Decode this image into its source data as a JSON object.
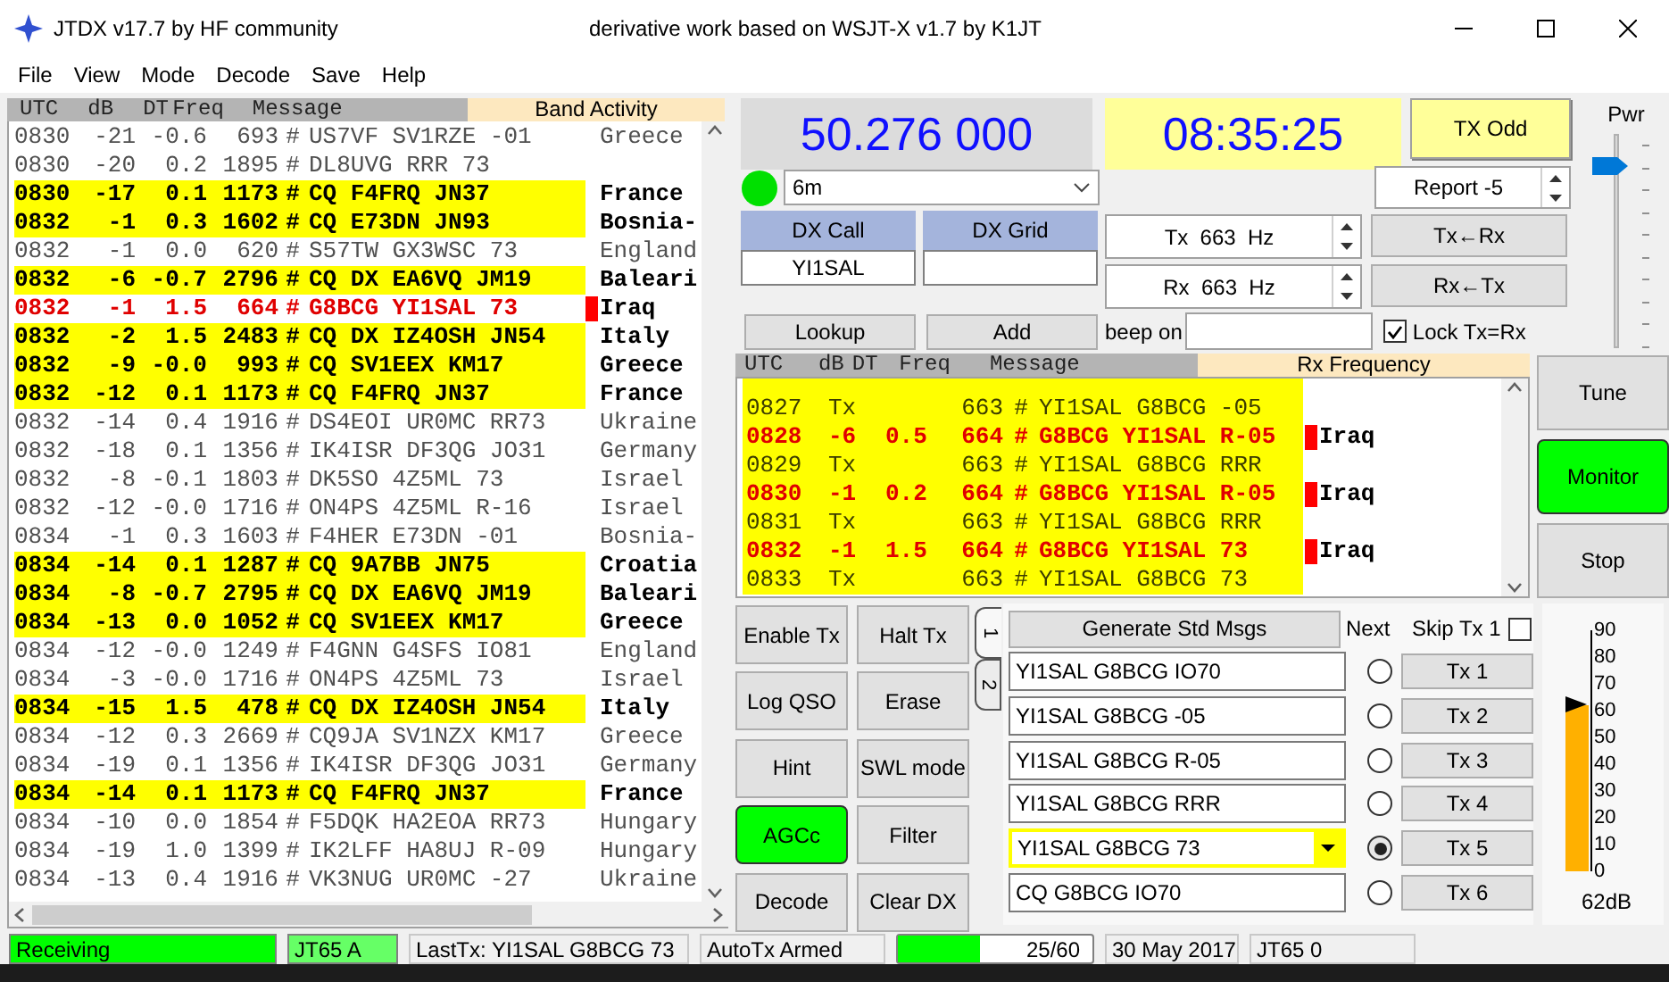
{
  "window": {
    "title": "JTDX v17.7  by HF community",
    "subtitle": "derivative work based on WSJT-X v1.7 by K1JT"
  },
  "menu": [
    "File",
    "View",
    "Mode",
    "Decode",
    "Save",
    "Help"
  ],
  "band_activity": {
    "title": "Band Activity",
    "columns": [
      "UTC",
      "dB",
      "DT",
      "Freq",
      "Message"
    ],
    "rows": [
      {
        "utc": "0830",
        "db": "-21",
        "dt": "-0.6",
        "freq": "693",
        "mode": "#",
        "message": "US7VF SV1RZE -01",
        "country": "Greece",
        "kind": "normal"
      },
      {
        "utc": "0830",
        "db": "-20",
        "dt": "0.2",
        "freq": "1895",
        "mode": "#",
        "message": "DL8UVG RRR 73",
        "kind": "normal"
      },
      {
        "utc": "0830",
        "db": "-17",
        "dt": "0.1",
        "freq": "1173",
        "mode": "#",
        "message": "CQ F4FRQ JN37",
        "country": "France",
        "kind": "cq"
      },
      {
        "utc": "0832",
        "db": "-1",
        "dt": "0.3",
        "freq": "1602",
        "mode": "#",
        "message": "CQ E73DN JN93",
        "country": "Bosnia-",
        "kind": "cq"
      },
      {
        "utc": "0832",
        "db": "-1",
        "dt": "0.0",
        "freq": "620",
        "mode": "#",
        "message": "S57TW GX3WSC 73",
        "country": "England",
        "kind": "normal"
      },
      {
        "utc": "0832",
        "db": "-6",
        "dt": "-0.7",
        "freq": "2796",
        "mode": "#",
        "message": "CQ DX EA6VQ JM19",
        "country": "Baleari",
        "kind": "cq"
      },
      {
        "utc": "0832",
        "db": "-1",
        "dt": "1.5",
        "freq": "664",
        "mode": "#",
        "message": "G8BCG YI1SAL 73",
        "country": "Iraq",
        "kind": "mine"
      },
      {
        "utc": "0832",
        "db": "-2",
        "dt": "1.5",
        "freq": "2483",
        "mode": "#",
        "message": "CQ DX IZ4OSH JN54",
        "country": "Italy",
        "kind": "cq"
      },
      {
        "utc": "0832",
        "db": "-9",
        "dt": "-0.0",
        "freq": "993",
        "mode": "#",
        "message": "CQ SV1EEX KM17",
        "country": "Greece",
        "kind": "cq"
      },
      {
        "utc": "0832",
        "db": "-12",
        "dt": "0.1",
        "freq": "1173",
        "mode": "#",
        "message": "CQ F4FRQ JN37",
        "country": "France",
        "kind": "cq"
      },
      {
        "utc": "0832",
        "db": "-14",
        "dt": "0.4",
        "freq": "1916",
        "mode": "#",
        "message": "DS4EOI UR0MC RR73",
        "country": "Ukraine",
        "kind": "normal"
      },
      {
        "utc": "0832",
        "db": "-18",
        "dt": "0.1",
        "freq": "1356",
        "mode": "#",
        "message": "IK4ISR DF3QG JO31",
        "country": "Germany",
        "kind": "normal"
      },
      {
        "utc": "0832",
        "db": "-8",
        "dt": "-0.1",
        "freq": "1803",
        "mode": "#",
        "message": "DK5SO 4Z5ML 73",
        "country": "Israel",
        "kind": "normal"
      },
      {
        "utc": "0832",
        "db": "-12",
        "dt": "-0.0",
        "freq": "1716",
        "mode": "#",
        "message": "ON4PS 4Z5ML R-16",
        "country": "Israel",
        "kind": "normal"
      },
      {
        "utc": "0834",
        "db": "-1",
        "dt": "0.3",
        "freq": "1603",
        "mode": "#",
        "message": "F4HER E73DN -01",
        "country": "Bosnia-",
        "kind": "normal"
      },
      {
        "utc": "0834",
        "db": "-14",
        "dt": "0.1",
        "freq": "1287",
        "mode": "#",
        "message": "CQ 9A7BB JN75",
        "country": "Croatia",
        "kind": "cq"
      },
      {
        "utc": "0834",
        "db": "-8",
        "dt": "-0.7",
        "freq": "2795",
        "mode": "#",
        "message": "CQ DX EA6VQ JM19",
        "country": "Baleari",
        "kind": "cq"
      },
      {
        "utc": "0834",
        "db": "-13",
        "dt": "0.0",
        "freq": "1052",
        "mode": "#",
        "message": "CQ SV1EEX KM17",
        "country": "Greece",
        "kind": "cq"
      },
      {
        "utc": "0834",
        "db": "-12",
        "dt": "-0.0",
        "freq": "1249",
        "mode": "#",
        "message": "F4GNN G4SFS IO81",
        "country": "England",
        "kind": "normal"
      },
      {
        "utc": "0834",
        "db": "-3",
        "dt": "-0.0",
        "freq": "1716",
        "mode": "#",
        "message": "ON4PS 4Z5ML 73",
        "country": "Israel",
        "kind": "normal"
      },
      {
        "utc": "0834",
        "db": "-15",
        "dt": "1.5",
        "freq": "478",
        "mode": "#",
        "message": "CQ DX IZ4OSH JN54",
        "country": "Italy",
        "kind": "cq"
      },
      {
        "utc": "0834",
        "db": "-12",
        "dt": "0.3",
        "freq": "2669",
        "mode": "#",
        "message": "CQ9JA SV1NZX KM17",
        "country": "Greece",
        "kind": "normal"
      },
      {
        "utc": "0834",
        "db": "-19",
        "dt": "0.1",
        "freq": "1356",
        "mode": "#",
        "message": "IK4ISR DF3QG JO31",
        "country": "Germany",
        "kind": "normal"
      },
      {
        "utc": "0834",
        "db": "-14",
        "dt": "0.1",
        "freq": "1173",
        "mode": "#",
        "message": "CQ F4FRQ JN37",
        "country": "France",
        "kind": "cq"
      },
      {
        "utc": "0834",
        "db": "-10",
        "dt": "0.0",
        "freq": "1854",
        "mode": "#",
        "message": "F5DQK HA2EOA RR73",
        "country": "Hungary",
        "kind": "normal"
      },
      {
        "utc": "0834",
        "db": "-19",
        "dt": "1.0",
        "freq": "1399",
        "mode": "#",
        "message": "IK2LFF HA8UJ R-09",
        "country": "Hungary",
        "kind": "normal"
      },
      {
        "utc": "0834",
        "db": "-13",
        "dt": "0.4",
        "freq": "1916",
        "mode": "#",
        "message": "VK3NUG UR0MC -27",
        "country": "Ukraine",
        "kind": "normal"
      }
    ]
  },
  "frequency": "50.276 000",
  "clock": "08:35:25",
  "tx_odd_button": "TX Odd",
  "band": {
    "value": "6m"
  },
  "dx_call": {
    "label": "DX Call",
    "value": "YI1SAL"
  },
  "dx_grid": {
    "label": "DX Grid"
  },
  "lookup_button": "Lookup",
  "add_button": "Add",
  "report": "Report -5",
  "tx_freq": "Tx  663  Hz",
  "rx_freq": "Rx  663  Hz",
  "tx_from_rx_button": "Tx←Rx",
  "rx_from_tx_button": "Rx←Tx",
  "beep_on": {
    "label": "beep on"
  },
  "lock_tx_rx": {
    "label": "Lock Tx=Rx",
    "checked": true
  },
  "pwr": {
    "label": "Pwr",
    "level": 0.88
  },
  "rx_frequency": {
    "title": "Rx Frequency",
    "columns": [
      "UTC",
      "dB",
      "DT",
      "Freq",
      "Message"
    ],
    "rows": [
      {
        "utc": "0827",
        "db": "Tx",
        "freq": "663",
        "mode": "#",
        "message": "YI1SAL G8BCG -05",
        "kind": "tx"
      },
      {
        "utc": "0828",
        "db": "-6",
        "dt": "0.5",
        "freq": "664",
        "mode": "#",
        "message": "G8BCG YI1SAL R-05",
        "country": "Iraq",
        "kind": "mine"
      },
      {
        "utc": "0829",
        "db": "Tx",
        "freq": "663",
        "mode": "#",
        "message": "YI1SAL G8BCG RRR",
        "kind": "tx"
      },
      {
        "utc": "0830",
        "db": "-1",
        "dt": "0.2",
        "freq": "664",
        "mode": "#",
        "message": "G8BCG YI1SAL R-05",
        "country": "Iraq",
        "kind": "mine"
      },
      {
        "utc": "0831",
        "db": "Tx",
        "freq": "663",
        "mode": "#",
        "message": "YI1SAL G8BCG RRR",
        "kind": "tx"
      },
      {
        "utc": "0832",
        "db": "-1",
        "dt": "1.5",
        "freq": "664",
        "mode": "#",
        "message": "G8BCG YI1SAL 73",
        "country": "Iraq",
        "kind": "mine"
      },
      {
        "utc": "0833",
        "db": "Tx",
        "freq": "663",
        "mode": "#",
        "message": "YI1SAL G8BCG 73",
        "kind": "tx"
      }
    ]
  },
  "side_buttons": [
    {
      "label": "Tune",
      "on": false
    },
    {
      "label": "Monitor",
      "on": true
    },
    {
      "label": "Stop",
      "on": false
    }
  ],
  "control_buttons": [
    {
      "label": "Enable Tx",
      "on": false
    },
    {
      "label": "Halt Tx",
      "on": false
    },
    {
      "label": "Log QSO",
      "on": false
    },
    {
      "label": "Erase",
      "on": false
    },
    {
      "label": "Hint",
      "on": false
    },
    {
      "label": "SWL mode",
      "on": false
    },
    {
      "label": "AGCc",
      "on": true
    },
    {
      "label": "Filter",
      "on": false
    },
    {
      "label": "Decode",
      "on": false
    },
    {
      "label": "Clear DX",
      "on": false
    }
  ],
  "message_tabs": [
    {
      "label": "1",
      "selected": true
    },
    {
      "label": "2",
      "selected": false
    }
  ],
  "generate_button": "Generate Std Msgs",
  "next_label": "Next",
  "skip_tx1": {
    "label": "Skip Tx 1",
    "checked": false
  },
  "messages": [
    {
      "text": "YI1SAL G8BCG IO70",
      "kind": "field",
      "selected": false,
      "button": "Tx 1"
    },
    {
      "text": "YI1SAL G8BCG -05",
      "kind": "field",
      "selected": false,
      "button": "Tx 2"
    },
    {
      "text": "YI1SAL G8BCG R-05",
      "kind": "field",
      "selected": false,
      "button": "Tx 3"
    },
    {
      "text": "YI1SAL G8BCG RRR",
      "kind": "field",
      "selected": false,
      "button": "Tx 4"
    },
    {
      "text": "YI1SAL G8BCG 73",
      "kind": "combo",
      "selected": true,
      "button": "Tx 5"
    },
    {
      "text": "CQ G8BCG IO70",
      "kind": "field",
      "selected": false,
      "button": "Tx 6"
    }
  ],
  "signal_meter": {
    "ticks": [
      "90",
      "80",
      "70",
      "60",
      "50",
      "40",
      "30",
      "20",
      "10",
      "0"
    ],
    "level": 0.69,
    "reading": "62dB"
  },
  "status_bar": [
    {
      "text": "Receiving",
      "kind": "state"
    },
    {
      "text": "JT65 A",
      "kind": "mode"
    },
    {
      "text": "LastTx: YI1SAL G8BCG 73",
      "kind": "plain"
    },
    {
      "text": "AutoTx Armed",
      "kind": "plain"
    },
    {
      "text": "25/60",
      "kind": "progress",
      "level": 0.42
    },
    {
      "text": "30 May 2017",
      "kind": "plain"
    },
    {
      "text": "JT65 0",
      "kind": "plain"
    }
  ]
}
